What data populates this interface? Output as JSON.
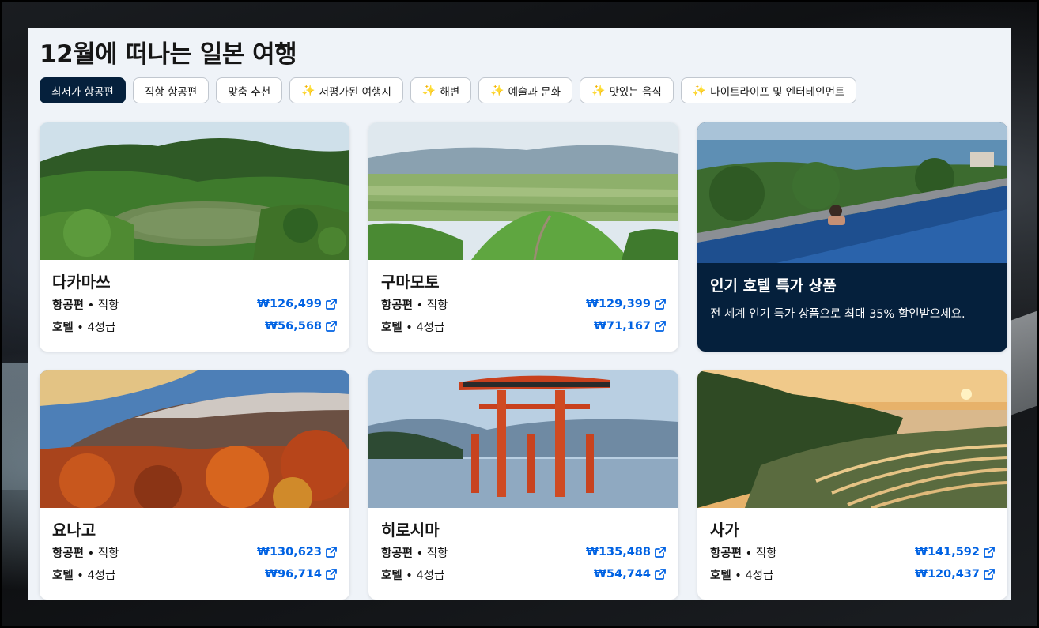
{
  "page": {
    "title": "12월에 떠나는 일본 여행"
  },
  "chips": [
    {
      "label": "최저가 항공편",
      "active": true,
      "sparkle": false
    },
    {
      "label": "직항 항공편",
      "active": false,
      "sparkle": false
    },
    {
      "label": "맞춤 추천",
      "active": false,
      "sparkle": false
    },
    {
      "label": "저평가된 여행지",
      "active": false,
      "sparkle": true
    },
    {
      "label": "해변",
      "active": false,
      "sparkle": true
    },
    {
      "label": "예술과 문화",
      "active": false,
      "sparkle": true
    },
    {
      "label": "맛있는 음식",
      "active": false,
      "sparkle": true
    },
    {
      "label": "나이트라이프 및 엔터테인먼트",
      "active": false,
      "sparkle": true
    }
  ],
  "sparkle_glyph": "✨",
  "labels": {
    "flight": "항공편",
    "flight_suffix": " • 직항",
    "hotel": "호텔",
    "hotel_suffix": " • 4성급"
  },
  "cards": [
    {
      "city": "다카마쓰",
      "flight_price": "₩126,499",
      "hotel_price": "₩56,568",
      "image": "japanese-garden-pond"
    },
    {
      "city": "구마모토",
      "flight_price": "₩129,399",
      "hotel_price": "₩71,167",
      "image": "green-valley-ridge"
    },
    {
      "city": "요나고",
      "flight_price": "₩130,623",
      "hotel_price": "₩96,714",
      "image": "autumn-mountain"
    },
    {
      "city": "히로시마",
      "flight_price": "₩135,488",
      "hotel_price": "₩54,744",
      "image": "torii-gate-sea"
    },
    {
      "city": "사가",
      "flight_price": "₩141,592",
      "hotel_price": "₩120,437",
      "image": "rice-terraces-sunset"
    }
  ],
  "promo": {
    "title": "인기 호텔 특가 상품",
    "text": "전 세계 인기 특가 상품으로 최대 35% 할인받으세요.",
    "image": "infinity-pool-ocean"
  },
  "colors": {
    "navy": "#05203c",
    "price_blue": "#0062e3",
    "panel_bg": "#eff3f8",
    "sparkle": "#f2b530"
  }
}
